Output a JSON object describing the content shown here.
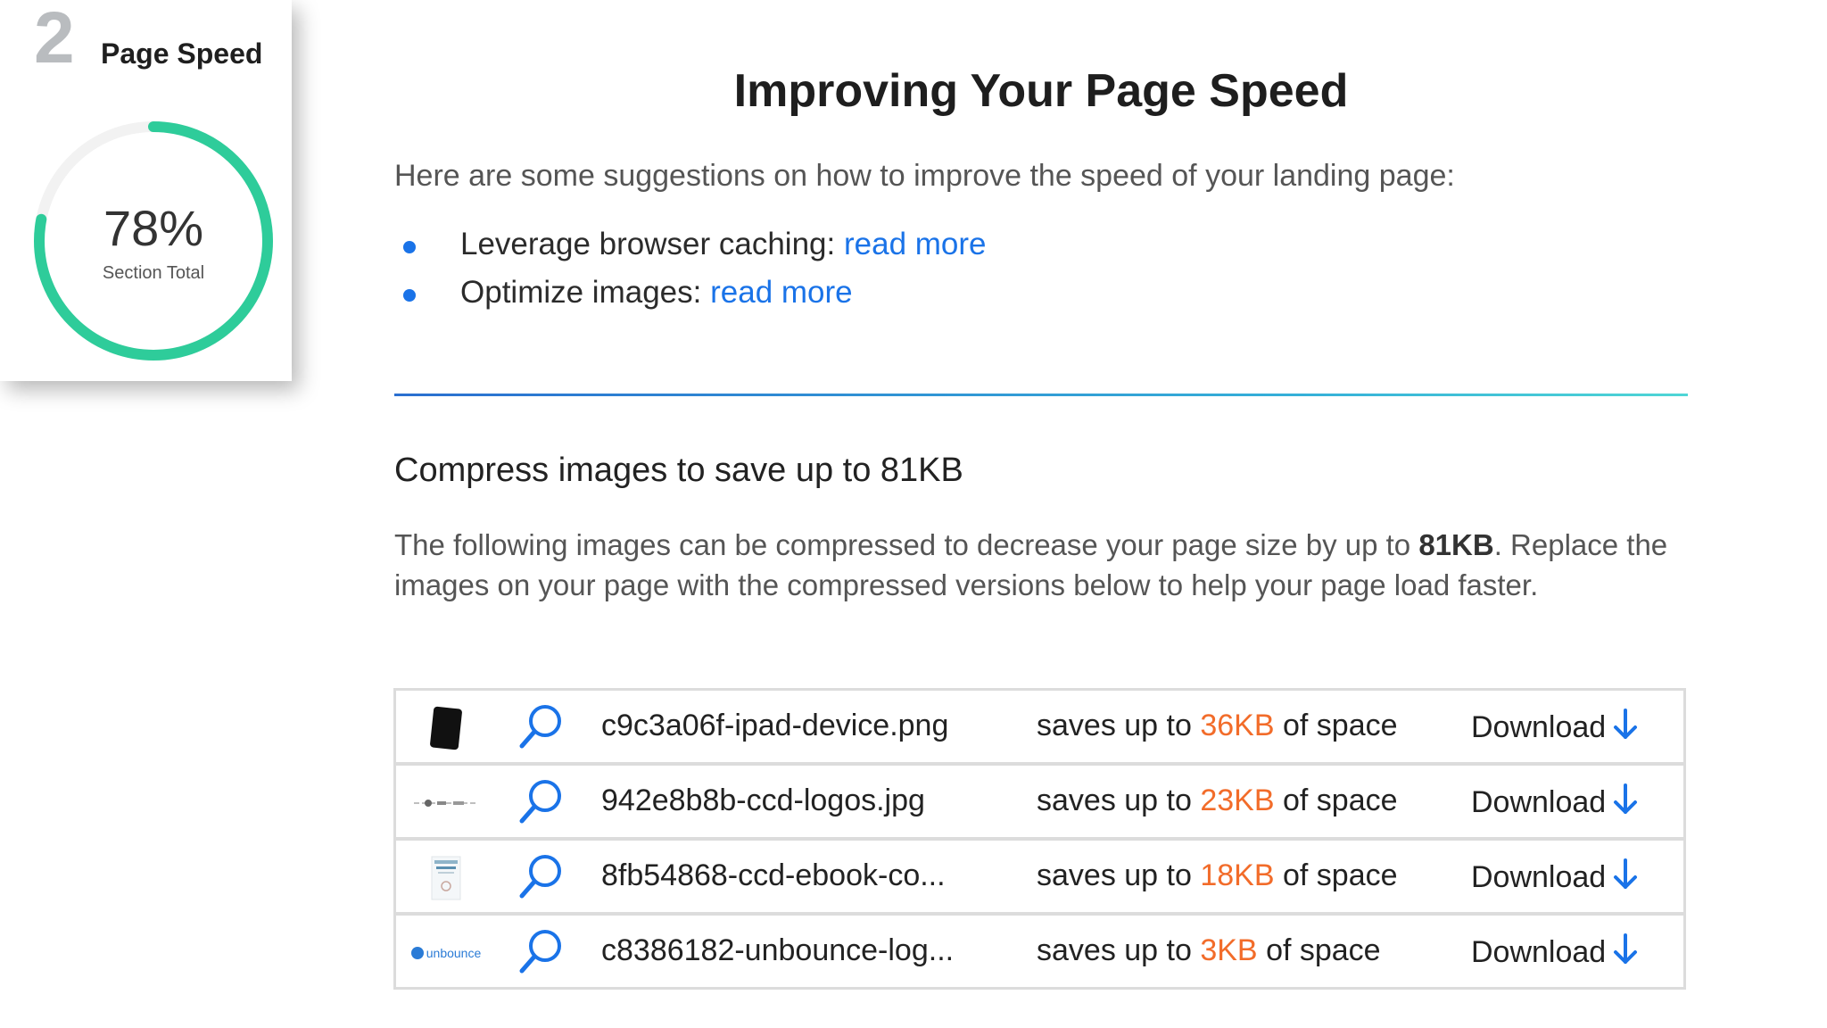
{
  "score_card": {
    "section_number": "2",
    "title": "Page Speed",
    "percent_value": 78,
    "percent_label": "78%",
    "subtitle": "Section Total",
    "ring_color": "#2ecc9a"
  },
  "main": {
    "title": "Improving Your Page Speed",
    "intro": "Here are some suggestions on how to improve the speed of your landing page:",
    "suggestions": [
      {
        "text": "Leverage browser caching:",
        "link": "read more"
      },
      {
        "text": "Optimize images:",
        "link": "read more"
      }
    ]
  },
  "compress": {
    "title": "Compress images to save up to 81KB",
    "desc_before": "The following images can be compressed to decrease your page size by up to ",
    "desc_bold": "81KB",
    "desc_after": ". Replace the images on your page with the compressed versions below to help your page load faster.",
    "saves_prefix": "saves up to",
    "saves_suffix": "of space",
    "download_label": "Download",
    "files": [
      {
        "thumb": "tablet-thumbnail",
        "name": "c9c3a06f-ipad-device.png",
        "size": "36KB"
      },
      {
        "thumb": "logos-strip-thumbnail",
        "name": "942e8b8b-ccd-logos.jpg",
        "size": "23KB"
      },
      {
        "thumb": "ebook-cover-thumbnail",
        "name": "8fb54868-ccd-ebook-co...",
        "size": "18KB"
      },
      {
        "thumb": "unbounce-logo-thumbnail",
        "name": "c8386182-unbounce-log...",
        "size": "3KB",
        "thumb_text": "unbounce"
      }
    ]
  },
  "colors": {
    "accent_blue": "#1a73e8",
    "savings_orange": "#f26c2a",
    "ring_track": "#f2f2f2"
  }
}
